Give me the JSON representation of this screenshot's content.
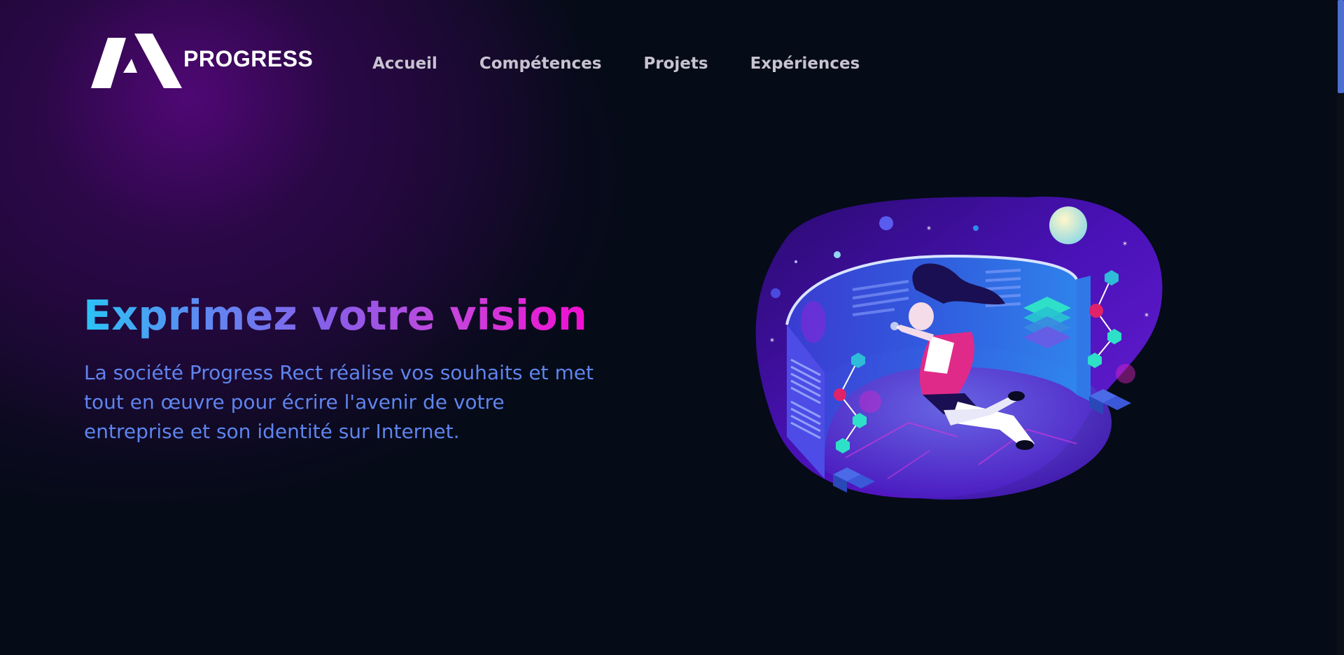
{
  "brand": {
    "name": "PROGRESS"
  },
  "nav": {
    "items": [
      {
        "label": "Accueil"
      },
      {
        "label": "Compétences"
      },
      {
        "label": "Projets"
      },
      {
        "label": "Expériences"
      }
    ]
  },
  "hero": {
    "title": "Exprimez votre vision",
    "description": "La société Progress Rect réalise vos souhaits et met tout en œuvre pour écrire l'avenir de votre entreprise et son identité sur Internet."
  },
  "illustration": {
    "icon": "floating-woman-hologram-illustration"
  },
  "colors": {
    "background": "#050b17",
    "accent_purple": "#520878",
    "nav_text": "#c8c3d0",
    "description_text": "#5f84ee",
    "gradient_start": "#2bc4f6",
    "gradient_end": "#f20ed2",
    "scroll_thumb": "#4d6fd0"
  }
}
